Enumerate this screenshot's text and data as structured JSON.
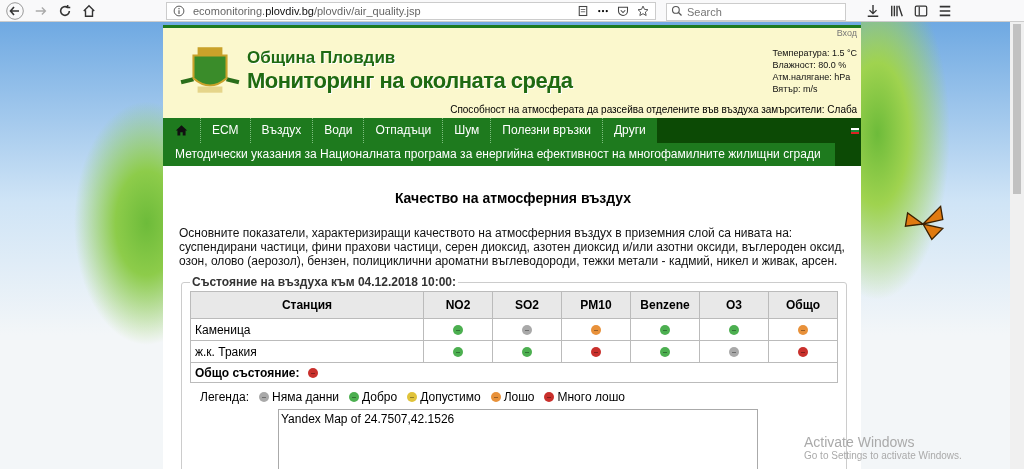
{
  "browser": {
    "url_prefix": "ecomonitoring.",
    "url_domain": "plovdiv.bg",
    "url_path": "/plovdiv/air_quality.jsp",
    "search_placeholder": "Search"
  },
  "header": {
    "login": "Вход",
    "municipality": "Община Пловдив",
    "site_title": "Мониторинг на околната среда",
    "weather": [
      "Температура: 1.5 °C",
      "Влажност: 80.0 %",
      "Атм.налягане: hPa",
      "Вятър: m/s"
    ],
    "dispersion": "Способност на атмосферата да разсейва отделените във въздуха замърсители: Слаба"
  },
  "nav": [
    {
      "label": "ЕСМ",
      "selected": false
    },
    {
      "label": "Въздух",
      "selected": false
    },
    {
      "label": "Води",
      "selected": false
    },
    {
      "label": "Отпадъци",
      "selected": false
    },
    {
      "label": "Шум",
      "selected": false
    },
    {
      "label": "Полезни връзки",
      "selected": false
    },
    {
      "label": "Други",
      "selected": false
    }
  ],
  "subnav": "Методически указания за Националната програма за енергийна ефективност на многофамилните жилищни сгради",
  "heading": "Качество на атмосферния въздух",
  "intro": "Основните показатели, характеризиращи качеството на атмосферния въздух в приземния слой са нивата на: суспендирани частици, фини прахови частици, серен диоксид, азотен диоксид и/или азотни оксиди, въглероден оксид, озон, олово (аерозол), бензен, полициклични ароматни въглеводороди, тежки метали - кадмий, никел и живак, арсен.",
  "status_box": {
    "legend": "Състояние на въздуха към 04.12.2018 10:00:",
    "columns": [
      "Станция",
      "NO2",
      "SO2",
      "PM10",
      "Benzene",
      "O3",
      "Общо"
    ],
    "rows": [
      {
        "station": "Каменица",
        "cells": [
          {
            "color": "#4caf50"
          },
          {
            "color": "#a9a9a9"
          },
          {
            "color": "#e8913a"
          },
          {
            "color": "#4caf50"
          },
          {
            "color": "#4caf50"
          },
          {
            "color": "#e8913a"
          }
        ]
      },
      {
        "station": "ж.к. Тракия",
        "cells": [
          {
            "color": "#4caf50"
          },
          {
            "color": "#4caf50"
          },
          {
            "color": "#c9302c"
          },
          {
            "color": "#4caf50"
          },
          {
            "color": "#a9a9a9"
          },
          {
            "color": "#c9302c"
          }
        ]
      }
    ],
    "overall": {
      "label": "Общо състояние:",
      "color": "#c9302c"
    }
  },
  "legend_label": "Легенда:",
  "legend": [
    {
      "color": "#a9a9a9",
      "label": "Няма данни"
    },
    {
      "color": "#4caf50",
      "label": "Добро"
    },
    {
      "color": "#e0c33a",
      "label": "Допустимо"
    },
    {
      "color": "#e8913a",
      "label": "Лошо"
    },
    {
      "color": "#c9302c",
      "label": "Много лошо"
    }
  ],
  "map_alt": "Yandex Map of 24.7507,42.1526",
  "os_notice": {
    "title": "Activate Windows",
    "text": "Go to Settings to activate Windows."
  }
}
